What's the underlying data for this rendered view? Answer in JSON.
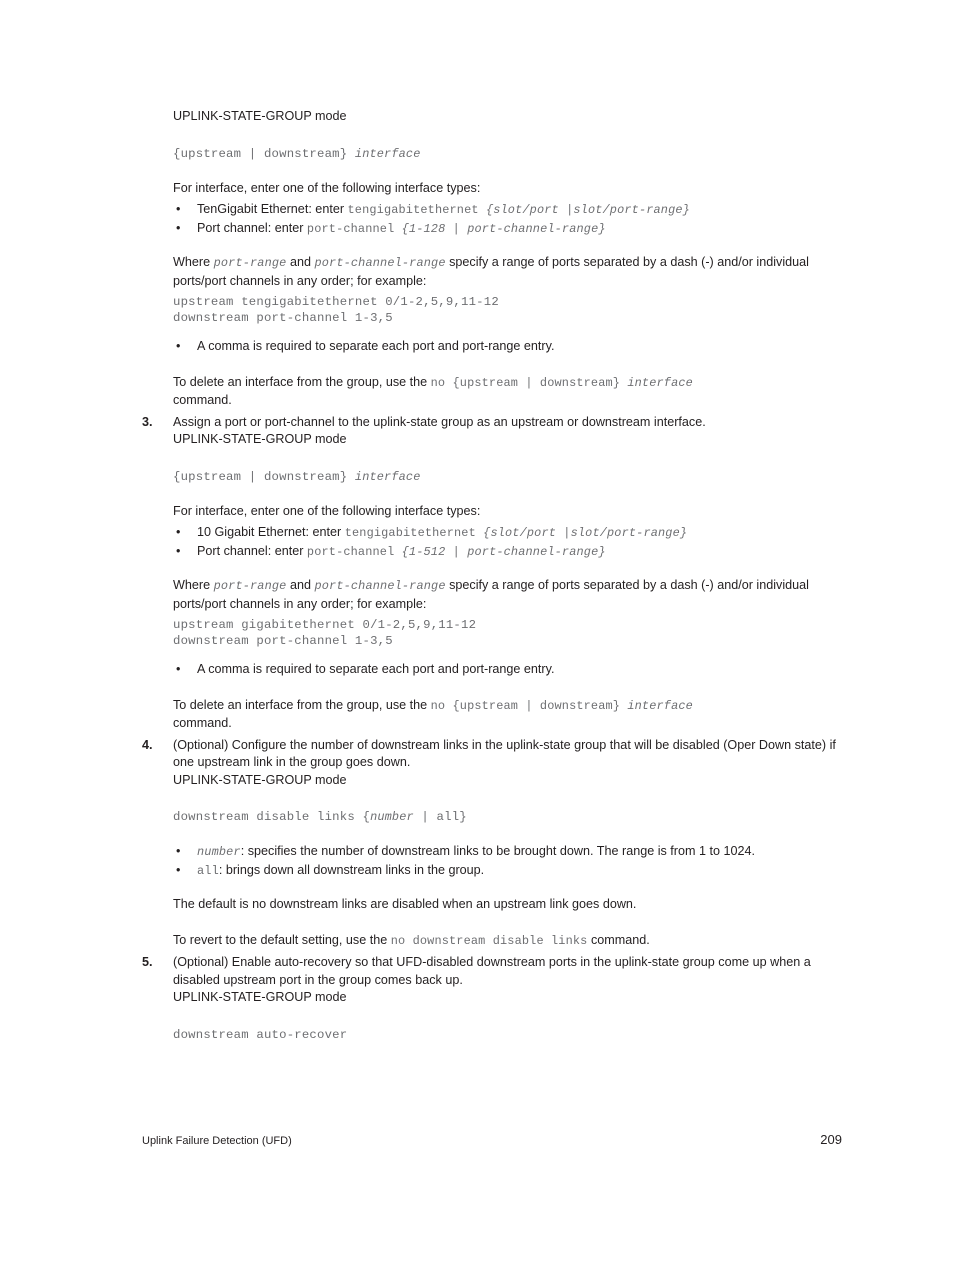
{
  "document": {
    "mode_label": "UPLINK-STATE-GROUP mode",
    "footer": {
      "left": "Uplink Failure Detection (UFD)",
      "page_number": "209"
    }
  },
  "block1": {
    "mode": "UPLINK-STATE-GROUP mode",
    "syntax_plain": "{upstream | downstream} ",
    "syntax_italic": "interface",
    "intro": "For interface, enter one of the following interface types:",
    "bullet1_label": "TenGigabit Ethernet: enter ",
    "bullet1_mono": "tengigabitethernet ",
    "bullet1_italic": "{slot/port |slot/port-range}",
    "bullet2_label": "Port channel: enter ",
    "bullet2_mono": "port-channel ",
    "bullet2_italic": "{1-128 | port-channel-range}",
    "where_pre": "Where ",
    "where_mono1": "port-range",
    "where_mid": " and ",
    "where_mono2": "port-channel-range",
    "where_post": " specify a range of ports separated by a dash (-) and/or individual ports/port channels in any order; for example:",
    "example_code": "upstream tengigabitethernet 0/1-2,5,9,11-12\ndownstream port-channel 1-3,5",
    "comma_bullet": "A comma is required to separate each port and port-range entry.",
    "delete_pre": "To delete an interface from the group, use the ",
    "delete_mono": "no {upstream | downstream} ",
    "delete_italic": "interface",
    "delete_post": "command."
  },
  "step3": {
    "number": "3.",
    "text": "Assign a port or port-channel to the uplink-state group as an upstream or downstream interface.",
    "mode": "UPLINK-STATE-GROUP mode",
    "syntax_plain": "{upstream | downstream} ",
    "syntax_italic": "interface",
    "intro": "For interface, enter one of the following interface types:",
    "bullet1_label": "10 Gigabit Ethernet: enter ",
    "bullet1_mono": "tengigabitethernet ",
    "bullet1_italic": "{slot/port |slot/port-range}",
    "bullet2_label": "Port channel: enter ",
    "bullet2_mono": "port-channel ",
    "bullet2_italic": "{1-512 | port-channel-range}",
    "where_pre": "Where ",
    "where_mono1": "port-range",
    "where_mid": " and ",
    "where_mono2": "port-channel-range",
    "where_post": " specify a range of ports separated by a dash (-) and/or individual ports/port channels in any order; for example:",
    "example_code": "upstream gigabitethernet 0/1-2,5,9,11-12\ndownstream port-channel 1-3,5",
    "comma_bullet": "A comma is required to separate each port and port-range entry.",
    "delete_pre": "To delete an interface from the group, use the ",
    "delete_mono": "no {upstream | downstream} ",
    "delete_italic": "interface",
    "delete_post": "command."
  },
  "step4": {
    "number": "4.",
    "text": "(Optional) Configure the number of downstream links in the uplink-state group that will be disabled (Oper Down state) if one upstream link in the group goes down.",
    "mode": "UPLINK-STATE-GROUP mode",
    "syntax_plain": "downstream disable links {",
    "syntax_italic": "number",
    "syntax_plain2": " | all}",
    "bullet1_mono": "number",
    "bullet1_text": ": specifies the number of downstream links to be brought down. The range is from 1 to 1024.",
    "bullet2_mono": "all",
    "bullet2_text": ": brings down all downstream links in the group.",
    "default_note": "The default is no downstream links are disabled when an upstream link goes down.",
    "revert_pre": "To revert to the default setting, use the ",
    "revert_mono": "no downstream disable links",
    "revert_post": " command."
  },
  "step5": {
    "number": "5.",
    "text": "(Optional) Enable auto-recovery so that UFD-disabled downstream ports in the uplink-state group come up when a disabled upstream port in the group comes back up.",
    "mode": "UPLINK-STATE-GROUP mode",
    "syntax_code": "downstream auto-recover"
  }
}
